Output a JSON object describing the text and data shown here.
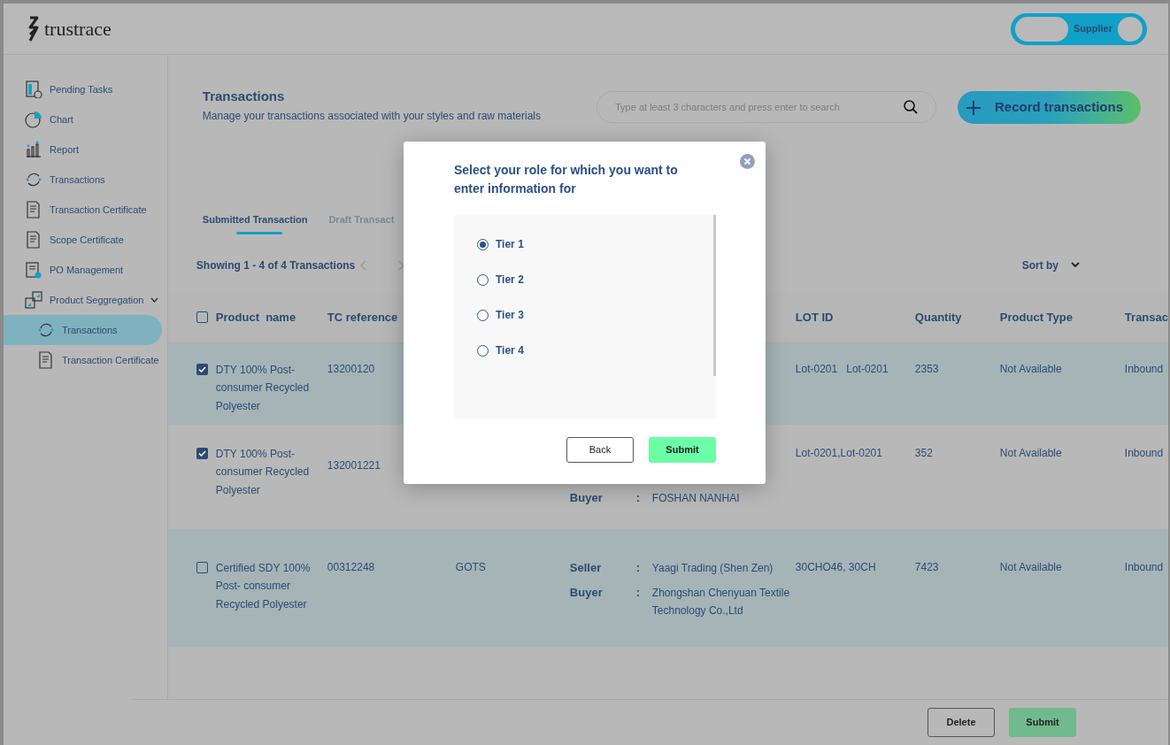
{
  "logo": "trustrace",
  "role_toggle": {
    "label": "Supplier",
    "on": true
  },
  "sidebar": {
    "items": [
      {
        "label": "Pending Tasks",
        "selected": false
      },
      {
        "label": "Chart",
        "selected": false
      },
      {
        "label": "Report",
        "selected": false
      },
      {
        "label": "Transactions",
        "selected": false
      },
      {
        "label": "Transaction Certificate",
        "selected": false
      },
      {
        "label": "Scope Certificate",
        "selected": false
      },
      {
        "label": "PO Management",
        "selected": false
      },
      {
        "label": "Product Seggregation",
        "selected": false,
        "expanded": true,
        "children": [
          {
            "label": "Transactions",
            "selected": true
          },
          {
            "label": "Transaction Certificate",
            "selected": false
          }
        ]
      }
    ]
  },
  "page": {
    "title": "Transactions",
    "subtitle": "Manage your transactions associated with your styles and raw materials"
  },
  "search": {
    "placeholder": "Type at least 3 characters and press enter to search"
  },
  "record_button": "Record transactions",
  "tabs": [
    {
      "label": "Submitted Transaction",
      "selected": true
    },
    {
      "label": "Draft Transact",
      "selected": false
    }
  ],
  "summary": "Showing 1 - 4 of 4 Transactions",
  "sort": "Sort by",
  "table": {
    "all_checked": false,
    "columns": [
      "Product  name",
      "TC reference",
      "LOT ID",
      "Quantity",
      "Product Type",
      "Transac"
    ],
    "rows": [
      {
        "checked": true,
        "product": "DTY 100% Post-consumer Recycled Polyester",
        "tc_reference": "13200120",
        "parties": [],
        "lot_id": "Lot-0201   Lot-0201",
        "quantity": "2353",
        "product_type": "Not Available",
        "transaction": "Inbound"
      },
      {
        "checked": true,
        "product": "DTY 100% Post-consumer Recycled Polyester",
        "tc_reference": "132001221",
        "parties": [
          {
            "role": "Buyer",
            "separator": ":",
            "name": "FOSHAN NANHAI"
          }
        ],
        "lot_id": "Lot-0201,Lot-0201",
        "quantity": "352",
        "product_type": "Not Available",
        "transaction": "Inbound"
      },
      {
        "checked": false,
        "product": "Certified SDY 100% Post- consumer Recycled Polyester",
        "tc_reference": "00312248",
        "certificate": "GOTS",
        "parties": [
          {
            "role": "Seller",
            "separator": ":",
            "name": "Yaagi Trading (Shen Zen)"
          },
          {
            "role": "Buyer",
            "separator": ":",
            "name": "Zhongshan Chenyuan Textile Technology Co.,Ltd"
          }
        ],
        "lot_id": "30CHO46, 30CH",
        "quantity": "7423",
        "product_type": "Not Available",
        "transaction": "Inbound"
      }
    ]
  },
  "modal": {
    "title": "Select your role for which you want to enter information for",
    "options": [
      {
        "label": "Tier 1",
        "selected": true
      },
      {
        "label": "Tier 2",
        "selected": false
      },
      {
        "label": "Tier 3",
        "selected": false
      },
      {
        "label": "Tier 4",
        "selected": false
      }
    ],
    "buttons": [
      {
        "label": "Back",
        "kind": "secondary"
      },
      {
        "label": "Submit",
        "kind": "primary"
      }
    ]
  },
  "footer_buttons": [
    {
      "label": "Delete",
      "kind": "secondary"
    },
    {
      "label": "Submit",
      "kind": "primary"
    }
  ]
}
